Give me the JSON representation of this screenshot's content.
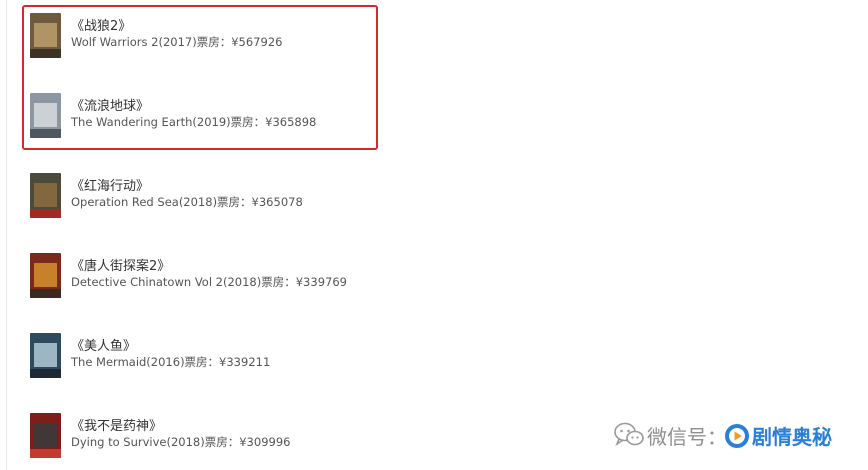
{
  "movies": [
    {
      "title": "《战狼2》",
      "info": "Wolf Warriors 2(2017)票房：¥567926",
      "poster_colors": [
        "#6e5a3f",
        "#b89a6a",
        "#3c3327"
      ]
    },
    {
      "title": "《流浪地球》",
      "info": "The Wandering Earth(2019)票房：¥365898",
      "poster_colors": [
        "#8c97a1",
        "#d3d7da",
        "#4e5860"
      ]
    },
    {
      "title": "《红海行动》",
      "info": "Operation Red Sea(2018)票房：¥365078",
      "poster_colors": [
        "#4b4a3b",
        "#8a6a3f",
        "#a32a21"
      ]
    },
    {
      "title": "《唐人街探案2》",
      "info": "Detective Chinatown Vol 2(2018)票房：¥339769",
      "poster_colors": [
        "#7a2a1c",
        "#d08a2c",
        "#3b2a22"
      ]
    },
    {
      "title": "《美人鱼》",
      "info": "The Mermaid(2016)票房：¥339211",
      "poster_colors": [
        "#2e4a5c",
        "#a9c2cf",
        "#1d2a33"
      ]
    },
    {
      "title": "《我不是药神》",
      "info": "Dying to Survive(2018)票房：¥309996",
      "poster_colors": [
        "#7c1f1b",
        "#3a3a3a",
        "#c23b2f"
      ]
    }
  ],
  "watermark": {
    "prefix": "微信号：",
    "account": "剧情奥秘",
    "chat_icon": "wechat-icon",
    "badge_icon": "play-badge-icon"
  },
  "highlight": {
    "color": "#d9272e"
  }
}
